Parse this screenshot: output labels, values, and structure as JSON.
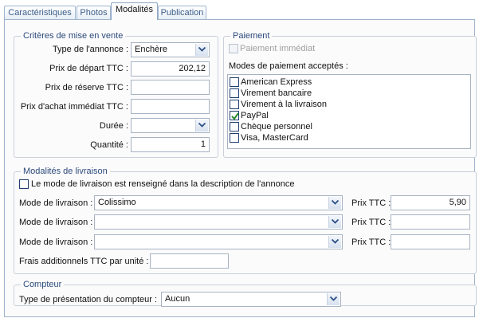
{
  "tabs": [
    {
      "label": "Caractéristiques",
      "active": false
    },
    {
      "label": "Photos",
      "active": false
    },
    {
      "label": "Modalités",
      "active": true
    },
    {
      "label": "Publication",
      "active": false
    }
  ],
  "criteres": {
    "title": "Critères de mise en vente",
    "type_annonce": {
      "label": "Type de l'annonce :",
      "value": "Enchère"
    },
    "prix_depart": {
      "label": "Prix de départ TTC :",
      "value": "202,12"
    },
    "prix_reserve": {
      "label": "Prix de réserve TTC :",
      "value": ""
    },
    "prix_achat": {
      "label": "Prix d'achat immédiat TTC :",
      "value": ""
    },
    "duree": {
      "label": "Durée :",
      "value": ""
    },
    "quantite": {
      "label": "Quantité :",
      "value": "1"
    }
  },
  "paiement": {
    "title": "Paiement",
    "immediat": {
      "label": "Paiement immédiat",
      "checked": false,
      "enabled": false
    },
    "modes_label": "Modes de paiement acceptés :",
    "modes": [
      {
        "label": "American Express",
        "checked": false
      },
      {
        "label": "Virement bancaire",
        "checked": false
      },
      {
        "label": "Virement à la livraison",
        "checked": false
      },
      {
        "label": "PayPal",
        "checked": true
      },
      {
        "label": "Chèque personnel",
        "checked": false
      },
      {
        "label": "Visa, MasterCard",
        "checked": false
      }
    ]
  },
  "livraison": {
    "title": "Modalités de livraison",
    "renseigne": {
      "label": "Le mode de livraison est renseigné dans la description de l'annonce",
      "checked": false
    },
    "rows": [
      {
        "mode_label": "Mode de livraison :",
        "mode_value": "Colissimo",
        "prix_label": "Prix TTC :",
        "prix_value": "5,90"
      },
      {
        "mode_label": "Mode de livraison :",
        "mode_value": "",
        "prix_label": "Prix TTC :",
        "prix_value": ""
      },
      {
        "mode_label": "Mode de livraison :",
        "mode_value": "",
        "prix_label": "Prix TTC :",
        "prix_value": ""
      }
    ],
    "frais": {
      "label": "Frais additionnels TTC par unité :",
      "value": ""
    }
  },
  "compteur": {
    "title": "Compteur",
    "type": {
      "label": "Type de présentation du compteur :",
      "value": "Aucun"
    }
  },
  "colors": {
    "group_title": "#2c4a7a",
    "tab_text": "#3d5f8a",
    "check": "#2a8a2a"
  }
}
